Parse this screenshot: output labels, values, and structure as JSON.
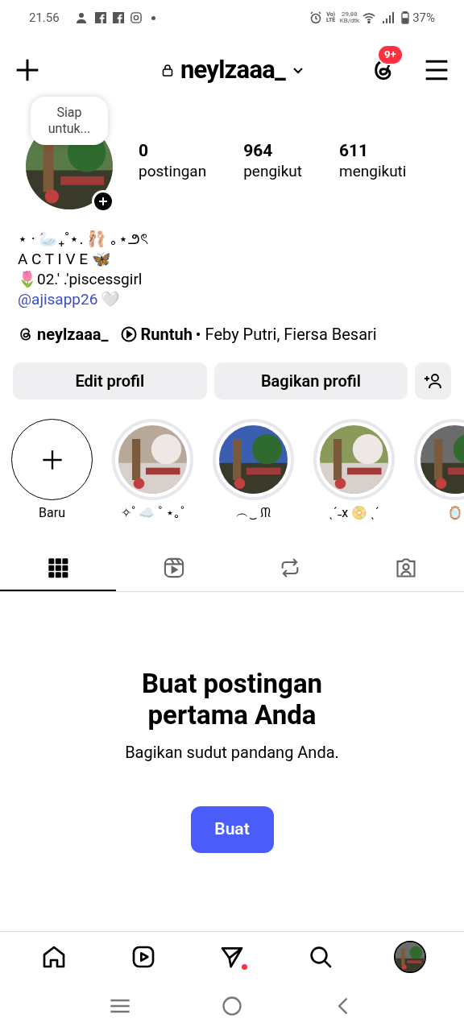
{
  "status_bar": {
    "time": "21.56",
    "network_top": "Vo) LTE",
    "speed": "29,88",
    "speed_unit": "KB/dtk",
    "battery": "37%"
  },
  "header": {
    "username": "neylzaaa_",
    "badge": "9+"
  },
  "profile": {
    "note": "Siap untuk...",
    "stats": [
      {
        "value": "0",
        "label": "postingan"
      },
      {
        "value": "964",
        "label": "pengikut"
      },
      {
        "value": "611",
        "label": "mengikuti"
      }
    ]
  },
  "bio": {
    "lines": [
      "⋆ · 🦢₊˚⋆. 🩰 ｡⋆౨ৎ",
      "A C T I V E 🦋",
      "🌷02.′ .′piscessgirl"
    ],
    "link": "@ajisapp26",
    "link_suffix": "🤍"
  },
  "threads_line": {
    "username": "neylzaaa_",
    "song": "Runtuh",
    "artists": "• Feby Putri, Fiersa Besari"
  },
  "buttons": [
    "Edit profil",
    "Bagikan profil"
  ],
  "highlights": [
    {
      "kind": "new",
      "label": "Baru"
    },
    {
      "kind": "picture",
      "label": "✧˚ ☁️ ˚ ⋆｡˚"
    },
    {
      "kind": "picture",
      "label": "︵‿ ᙏ"
    },
    {
      "kind": "picture",
      "label": "ˎˊ˗x 📀 ˎˊ"
    },
    {
      "kind": "picture",
      "label": "🪞"
    }
  ],
  "tabs": [
    {
      "kind": "grid",
      "selected": true
    },
    {
      "kind": "reels",
      "selected": false
    },
    {
      "kind": "reposts",
      "selected": false
    },
    {
      "kind": "tagged",
      "selected": false
    }
  ],
  "empty_state": {
    "title": "Buat postingan pertama Anda",
    "subtitle": "Bagikan sudut pandang Anda.",
    "button": "Buat"
  },
  "bottom_nav": [
    {
      "kind": "home",
      "dot": false
    },
    {
      "kind": "reels",
      "dot": false
    },
    {
      "kind": "direct",
      "dot": true
    },
    {
      "kind": "search",
      "dot": false
    },
    {
      "kind": "profile",
      "dot": false
    }
  ]
}
